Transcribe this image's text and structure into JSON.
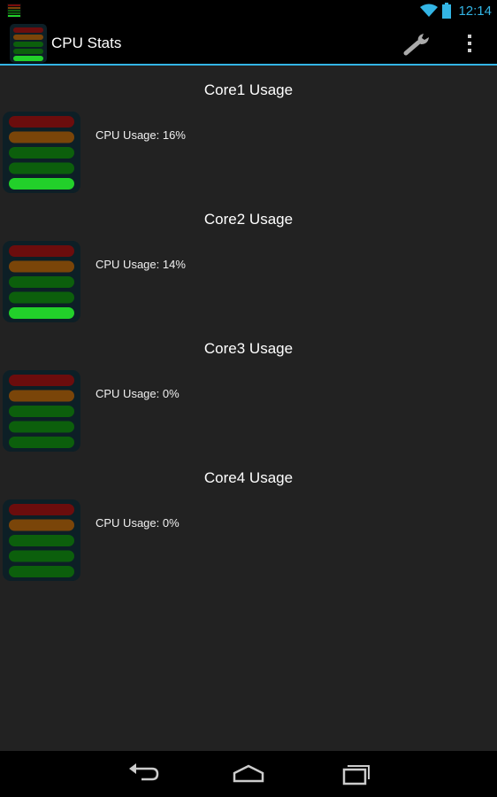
{
  "status_bar": {
    "time": "12:14",
    "icons": [
      "app-meter-icon",
      "wifi-icon",
      "battery-icon"
    ]
  },
  "action_bar": {
    "title": "CPU Stats",
    "actions": [
      "wrench-icon",
      "overflow-menu-icon"
    ],
    "accent_color": "#33b5e5"
  },
  "cores": [
    {
      "title": "Core1 Usage",
      "usage_text": "CPU Usage: 16%",
      "usage_percent": 16,
      "lit_bars": 1
    },
    {
      "title": "Core2 Usage",
      "usage_text": "CPU Usage: 14%",
      "usage_percent": 14,
      "lit_bars": 1
    },
    {
      "title": "Core3 Usage",
      "usage_text": "CPU Usage: 0%",
      "usage_percent": 0,
      "lit_bars": 0
    },
    {
      "title": "Core4 Usage",
      "usage_text": "CPU Usage: 0%",
      "usage_percent": 0,
      "lit_bars": 0
    }
  ],
  "meter_colors": {
    "red": "#6b0d0d",
    "orange": "#7a4509",
    "green_dark": "#0c5f0c",
    "green_lit": "#22d02a",
    "frame": "#0d1f26"
  },
  "nav_bar": {
    "buttons": [
      "back-icon",
      "home-icon",
      "recent-apps-icon"
    ]
  }
}
